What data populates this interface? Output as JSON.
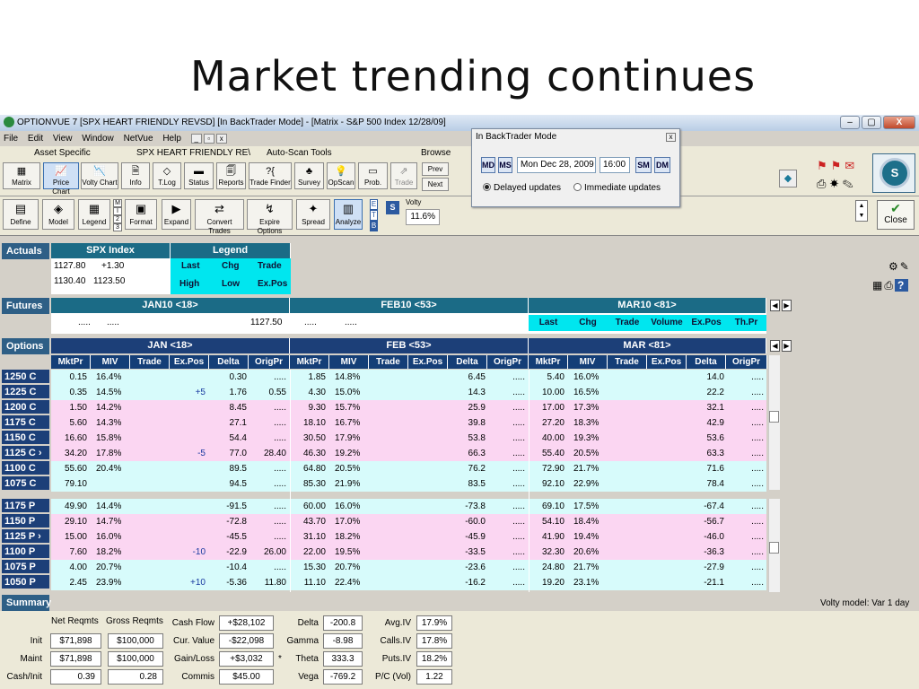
{
  "slide_title": "Market trending continues",
  "window": {
    "title": "OPTIONVUE 7   [SPX HEART FRIENDLY REVSD]  [In BackTrader Mode] - [Matrix - S&P 500 Index  12/28/09]",
    "min": "–",
    "max": "▢",
    "close": "X"
  },
  "menu": [
    "File",
    "Edit",
    "View",
    "Window",
    "NetVue",
    "Help"
  ],
  "mdi": [
    "_",
    "▫",
    "x"
  ],
  "groups": {
    "asset_specific": "Asset Specific",
    "portfolio": "SPX HEART FRIENDLY RE\\",
    "autoscan": "Auto-Scan Tools",
    "browse": "Browse"
  },
  "toolbar": [
    {
      "label": "Matrix",
      "icon": "▦"
    },
    {
      "label": "Price Chart",
      "icon": "📈"
    },
    {
      "label": "Volty Chart",
      "icon": "📉"
    },
    {
      "label": "Info",
      "icon": "🗎"
    },
    {
      "label": "T.Log",
      "icon": "◇"
    },
    {
      "label": "Status",
      "icon": "▬"
    },
    {
      "label": "Reports",
      "icon": "🗐"
    },
    {
      "label": "Trade Finder",
      "icon": "?{"
    },
    {
      "label": "Survey",
      "icon": "♣"
    },
    {
      "label": "OpScan",
      "icon": "💡"
    },
    {
      "label": "Prob.",
      "icon": "▭"
    },
    {
      "label": "Trade",
      "icon": "⇗"
    }
  ],
  "browse": {
    "prev": "Prev",
    "next": "Next"
  },
  "toolbar2": [
    {
      "label": "Define",
      "icon": "▤"
    },
    {
      "label": "Model",
      "icon": "◈"
    },
    {
      "label": "Legend",
      "icon": "▦"
    },
    {
      "label": "Format",
      "icon": "▣"
    },
    {
      "label": "Expand",
      "icon": "▶"
    },
    {
      "label": "Convert Trades",
      "icon": "⇄"
    },
    {
      "label": "Expire Options",
      "icon": "↯"
    },
    {
      "label": "Spread",
      "icon": "✦"
    },
    {
      "label": "Analyze",
      "icon": "▥"
    }
  ],
  "mini_stack": [
    "M",
    "I",
    "2",
    "3"
  ],
  "etb": [
    "E",
    "T",
    "B"
  ],
  "volty": {
    "s": "S",
    "label": "Volty",
    "value": "11.6%"
  },
  "close_label": "Close",
  "backtrader": {
    "title": "In BackTrader Mode",
    "close": "x",
    "btn1": "MD",
    "btn2": "MS",
    "date": "Mon Dec 28, 2009",
    "time": "16:00",
    "btn3": "SM",
    "btn4": "DM",
    "radio1": "Delayed updates",
    "radio2": "Immediate updates"
  },
  "actuals": {
    "label": "Actuals",
    "index_header": "SPX Index",
    "legend_header": "Legend",
    "row1": [
      "1127.80",
      "+1.30"
    ],
    "row2": [
      "1130.40",
      "1123.50"
    ],
    "legend_row1": [
      "Last",
      "Chg",
      "Trade"
    ],
    "legend_row2": [
      "High",
      "Low",
      "Ex.Pos"
    ]
  },
  "futures": {
    "label": "Futures",
    "months": [
      "JAN10 <18>",
      "FEB10 <53>",
      "MAR10 <81>"
    ],
    "cells": [
      ".....",
      ".....",
      "1127.50",
      ".....",
      "....."
    ],
    "cyan_headers": [
      "Last",
      "Chg",
      "Trade",
      "Volume",
      "Ex.Pos",
      "Th.Pr"
    ]
  },
  "options": {
    "label": "Options",
    "months": [
      "JAN <18>",
      "FEB <53>",
      "MAR <81>"
    ],
    "columns": [
      "MktPr",
      "MIV",
      "Trade",
      "Ex.Pos",
      "Delta",
      "OrigPr"
    ],
    "calls": [
      {
        "strike": "1250 C",
        "cells": [
          "0.15",
          "16.4%",
          "",
          "",
          "0.30",
          ".....",
          "1.85",
          "14.8%",
          "",
          "",
          "6.45",
          ".....",
          "5.40",
          "16.0%",
          "",
          "",
          "14.0",
          "....."
        ]
      },
      {
        "strike": "1225 C",
        "cells": [
          "0.35",
          "14.5%",
          "",
          "+5",
          "1.76",
          "0.55",
          "4.30",
          "15.0%",
          "",
          "",
          "14.3",
          ".....",
          "10.00",
          "16.5%",
          "",
          "",
          "22.2",
          "....."
        ]
      },
      {
        "strike": "1200 C",
        "cells": [
          "1.50",
          "14.2%",
          "",
          "",
          "8.45",
          ".....",
          "9.30",
          "15.7%",
          "",
          "",
          "25.9",
          ".....",
          "17.00",
          "17.3%",
          "",
          "",
          "32.1",
          "....."
        ]
      },
      {
        "strike": "1175 C",
        "cells": [
          "5.60",
          "14.3%",
          "",
          "",
          "27.1",
          ".....",
          "18.10",
          "16.7%",
          "",
          "",
          "39.8",
          ".....",
          "27.20",
          "18.3%",
          "",
          "",
          "42.9",
          "....."
        ]
      },
      {
        "strike": "1150 C",
        "cells": [
          "16.60",
          "15.8%",
          "",
          "",
          "54.4",
          ".....",
          "30.50",
          "17.9%",
          "",
          "",
          "53.8",
          ".....",
          "40.00",
          "19.3%",
          "",
          "",
          "53.6",
          "....."
        ]
      },
      {
        "strike": "1125 C ›",
        "cells": [
          "34.20",
          "17.8%",
          "",
          "-5",
          "77.0",
          "28.40",
          "46.30",
          "19.2%",
          "",
          "",
          "66.3",
          ".....",
          "55.40",
          "20.5%",
          "",
          "",
          "63.3",
          "....."
        ]
      },
      {
        "strike": "1100 C",
        "cells": [
          "55.60",
          "20.4%",
          "",
          "",
          "89.5",
          ".....",
          "64.80",
          "20.5%",
          "",
          "",
          "76.2",
          ".....",
          "72.90",
          "21.7%",
          "",
          "",
          "71.6",
          "....."
        ]
      },
      {
        "strike": "1075 C",
        "cells": [
          "79.10",
          "",
          "",
          "",
          "94.5",
          ".....",
          "85.30",
          "21.9%",
          "",
          "",
          "83.5",
          ".....",
          "92.10",
          "22.9%",
          "",
          "",
          "78.4",
          "....."
        ]
      }
    ],
    "puts": [
      {
        "strike": "1175 P",
        "cells": [
          "49.90",
          "14.4%",
          "",
          "",
          "-91.5",
          ".....",
          "60.00",
          "16.0%",
          "",
          "",
          "-73.8",
          ".....",
          "69.10",
          "17.5%",
          "",
          "",
          "-67.4",
          "....."
        ]
      },
      {
        "strike": "1150 P",
        "cells": [
          "29.10",
          "14.7%",
          "",
          "",
          "-72.8",
          ".....",
          "43.70",
          "17.0%",
          "",
          "",
          "-60.0",
          ".....",
          "54.10",
          "18.4%",
          "",
          "",
          "-56.7",
          "....."
        ]
      },
      {
        "strike": "1125 P ›",
        "cells": [
          "15.00",
          "16.0%",
          "",
          "",
          "-45.5",
          ".....",
          "31.10",
          "18.2%",
          "",
          "",
          "-45.9",
          ".....",
          "41.90",
          "19.4%",
          "",
          "",
          "-46.0",
          "....."
        ]
      },
      {
        "strike": "1100 P",
        "cells": [
          "7.60",
          "18.2%",
          "",
          "-10",
          "-22.9",
          "26.00",
          "22.00",
          "19.5%",
          "",
          "",
          "-33.5",
          ".....",
          "32.30",
          "20.6%",
          "",
          "",
          "-36.3",
          "....."
        ]
      },
      {
        "strike": "1075 P",
        "cells": [
          "4.00",
          "20.7%",
          "",
          "",
          "-10.4",
          ".....",
          "15.30",
          "20.7%",
          "",
          "",
          "-23.6",
          ".....",
          "24.80",
          "21.7%",
          "",
          "",
          "-27.9",
          "....."
        ]
      },
      {
        "strike": "1050 P",
        "cells": [
          "2.45",
          "23.9%",
          "",
          "+10",
          "-5.36",
          "11.80",
          "11.10",
          "22.4%",
          "",
          "",
          "-16.2",
          ".....",
          "19.20",
          "23.1%",
          "",
          "",
          "-21.1",
          "....."
        ]
      }
    ]
  },
  "summary": {
    "label": "Summary",
    "volty_model": "Volty model: Var 1 day",
    "headers": [
      "Net Reqmts",
      "Gross Reqmts"
    ],
    "rows": [
      {
        "label": "Init",
        "net": "$71,898",
        "gross": "$100,000"
      },
      {
        "label": "Maint",
        "net": "$71,898",
        "gross": "$100,000"
      },
      {
        "label": "Cash/Init",
        "net": "0.39",
        "gross": "0.28"
      }
    ],
    "mid": [
      {
        "label": "Cash Flow",
        "value": "+$28,102"
      },
      {
        "label": "Cur. Value",
        "value": "-$22,098"
      },
      {
        "label": "Gain/Loss",
        "value": "+$3,032"
      },
      {
        "label": "Commis",
        "value": "$45.00"
      }
    ],
    "greeks": [
      {
        "label": "Delta",
        "value": "-200.8"
      },
      {
        "label": "Gamma",
        "value": "-8.98"
      },
      {
        "label": "Theta",
        "value": "333.3"
      },
      {
        "label": "Vega",
        "value": "-769.2"
      }
    ],
    "iv": [
      {
        "label": "Avg.IV",
        "value": "17.9%"
      },
      {
        "label": "Calls.IV",
        "value": "17.8%"
      },
      {
        "label": "Puts.IV",
        "value": "18.2%"
      },
      {
        "label": "P/C (Vol)",
        "value": "1.22"
      }
    ],
    "star": "*"
  }
}
